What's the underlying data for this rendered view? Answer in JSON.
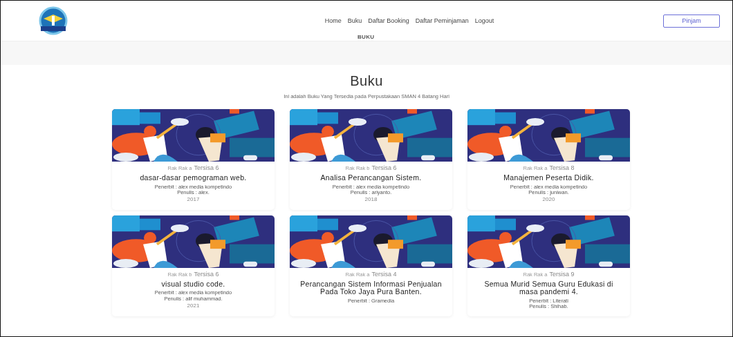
{
  "header": {
    "nav": [
      "Home",
      "Buku",
      "Daftar Booking",
      "Daftar Peminjaman",
      "Logout"
    ],
    "button": "Pinjam",
    "breadcrumb": "BUKU"
  },
  "page": {
    "title": "Buku",
    "subtitle": "Ini adalah Buku Yang Tersedia pada Perpustakaan SMAN 4 Batang Hari"
  },
  "books": [
    {
      "location": "Rak Rak a",
      "stock": "Tersisa 6",
      "title": "dasar-dasar pemograman web.",
      "publisher": "Penerbit : alex media kompetindo",
      "author": "Penulis : alex.",
      "year": "2017"
    },
    {
      "location": "Rak Rak b",
      "stock": "Tersisa 6",
      "title": "Analisa Perancangan Sistem.",
      "publisher": "Penerbit : alex media kompetindo",
      "author": "Penulis : ariyanto.",
      "year": "2018"
    },
    {
      "location": "Rak Rak a",
      "stock": "Tersisa 8",
      "title": "Manajemen Peserta Didik.",
      "publisher": "Penerbit : alex media kompetindo",
      "author": "Penulis : juniwan.",
      "year": "2020"
    },
    {
      "location": "Rak Rak b",
      "stock": "Tersisa 6",
      "title": "visual studio code.",
      "publisher": "Penerbit : alex media kompetindo",
      "author": "Penulis : alif muhammad.",
      "year": "2021"
    },
    {
      "location": "Rak Rak a",
      "stock": "Tersisa 4",
      "title": "Perancangan Sistem Informasi Penjualan Pada Toko Jaya Pura Banten.",
      "publisher": "Penerbit : Gramedia"
    },
    {
      "location": "Rak Rak a",
      "stock": "Tersisa 9",
      "title": "Semua Murid Semua Guru Edukasi di masa pandemi 4.",
      "publisher": "Penerbit : Literati",
      "author": "Penulis : Shihab."
    }
  ]
}
